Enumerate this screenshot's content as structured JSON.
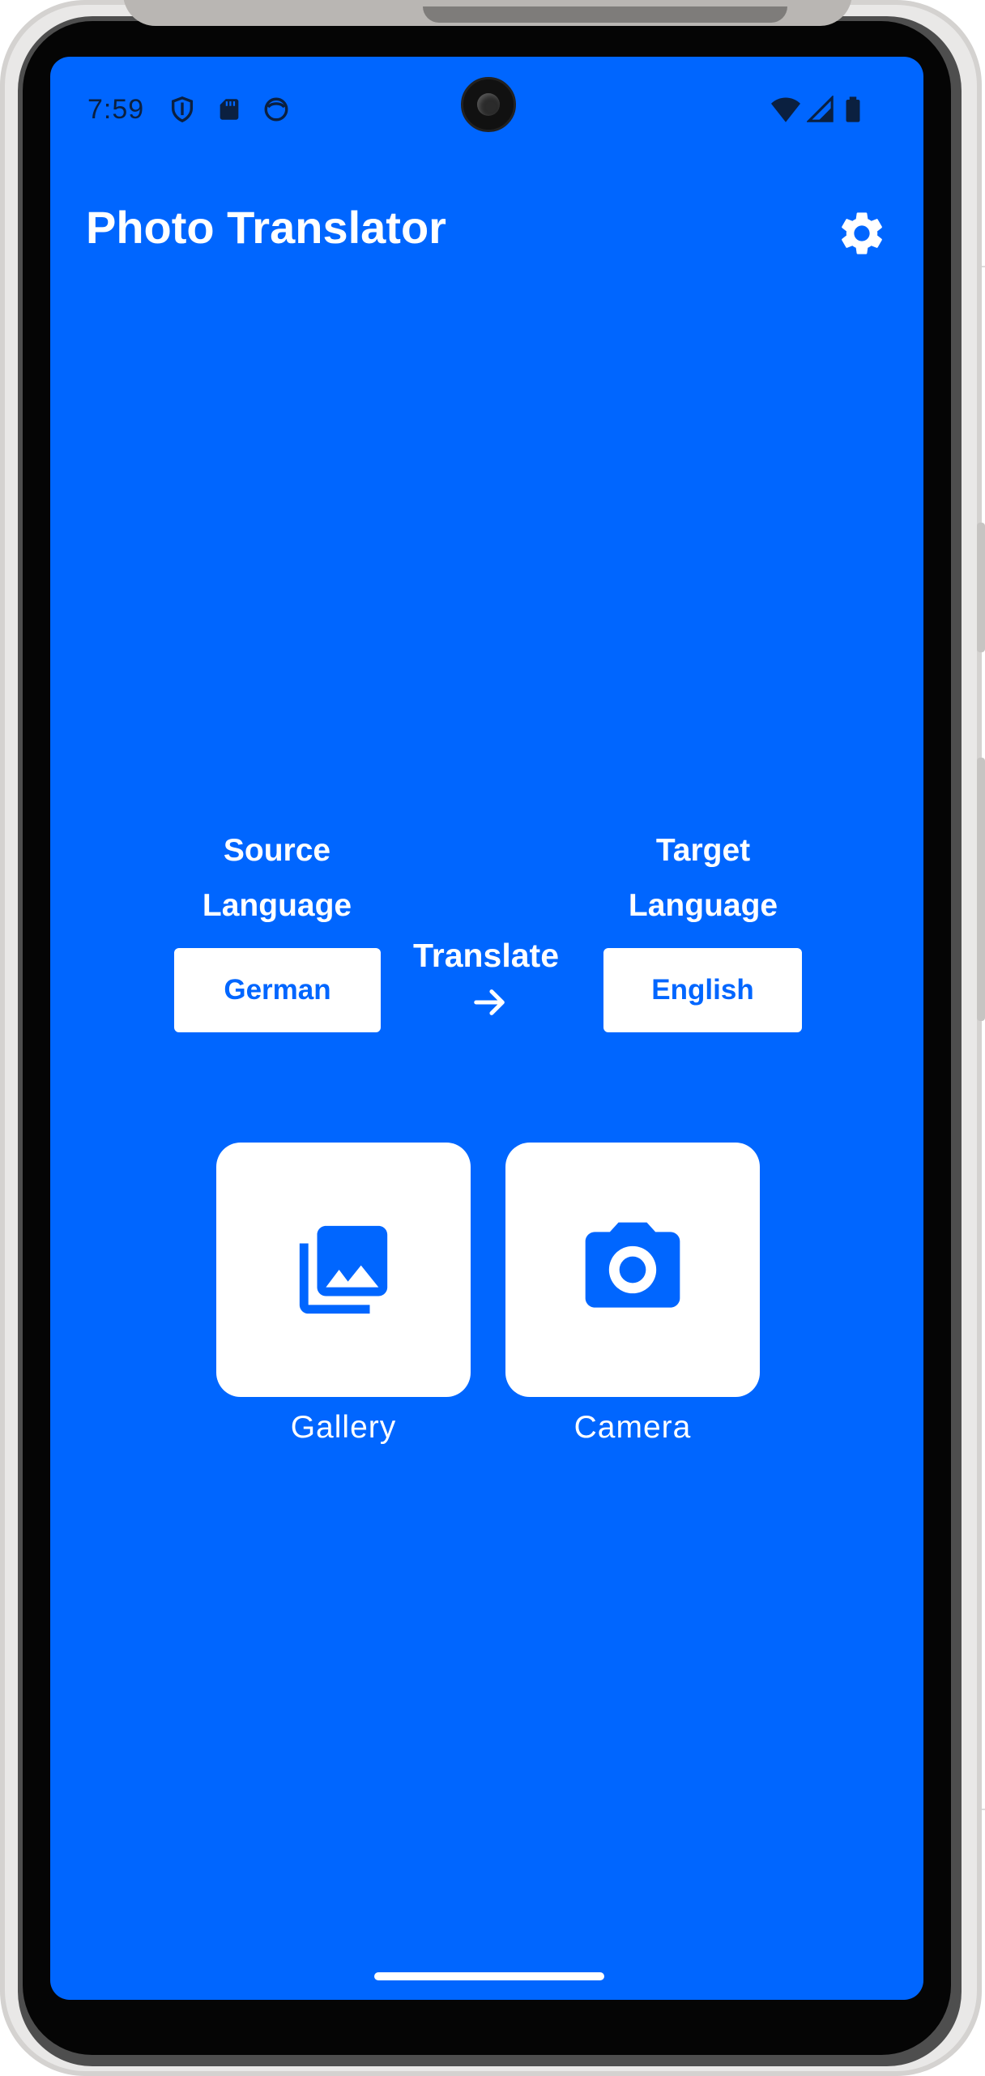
{
  "status_bar": {
    "time": "7:59",
    "left_icons": [
      "shield-icon",
      "sd-card-icon",
      "face-icon"
    ],
    "right_icons": [
      "wifi-icon",
      "signal-icon",
      "battery-icon"
    ]
  },
  "app_bar": {
    "title": "Photo Translator",
    "settings_icon": "gear-icon"
  },
  "translation": {
    "source_label_line1": "Source",
    "source_label_line2": "Language",
    "translate_label": "Translate",
    "arrow_icon": "arrow-right-icon",
    "target_label_line1": "Target",
    "target_label_line2": "Language",
    "source_language": "German",
    "target_language": "English"
  },
  "actions": [
    {
      "label": "Gallery",
      "icon": "photo-library-icon"
    },
    {
      "label": "Camera",
      "icon": "camera-icon"
    }
  ],
  "colors": {
    "primary": "#0066ff",
    "on_primary": "#ffffff",
    "status_icons": "#0b2040"
  }
}
